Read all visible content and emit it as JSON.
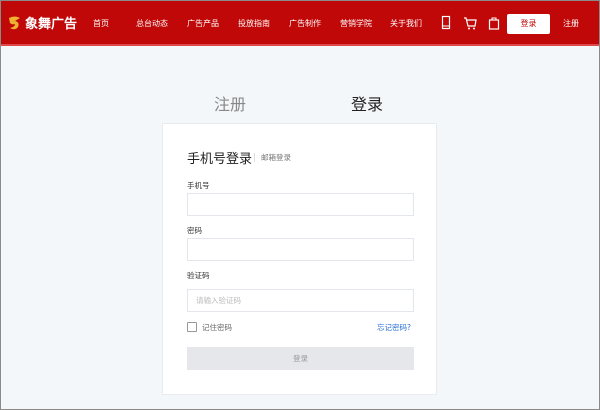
{
  "header": {
    "brand": "象舞广告",
    "nav": [
      "首页",
      "总台动态",
      "广告产品",
      "投放指南",
      "广告制作",
      "营销学院",
      "关于我们"
    ],
    "icons": [
      "mobile-icon",
      "cart-icon",
      "bag-icon"
    ],
    "login": "登录",
    "register": "注册",
    "color": "#c00808"
  },
  "tabs": {
    "register": "注册",
    "login": "登录"
  },
  "form": {
    "title": "手机号登录",
    "alt_login": "邮箱登录",
    "phone_label": "手机号",
    "phone_value": "",
    "password_label": "密码",
    "password_value": "",
    "captcha_label": "验证码",
    "captcha_placeholder": "请输入验证码",
    "remember": "记住密码",
    "remember_checked": false,
    "forgot": "忘记密码?",
    "submit": "登录"
  }
}
